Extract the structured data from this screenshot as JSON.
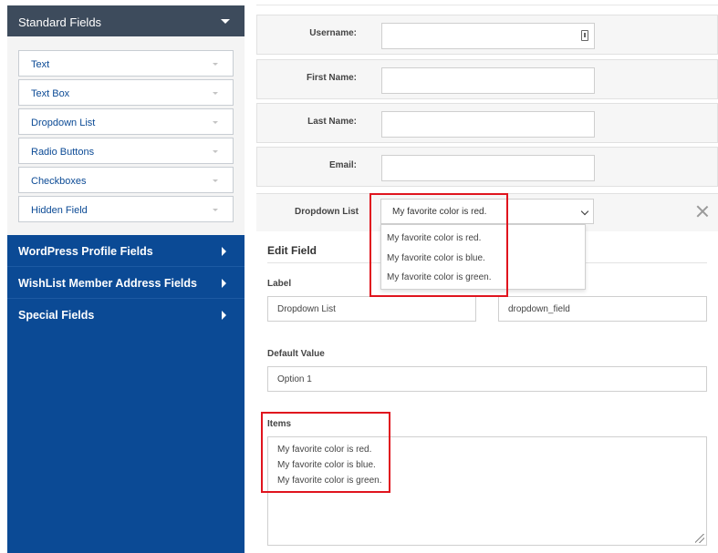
{
  "sidebar": {
    "header": "Standard Fields",
    "standard_fields": [
      "Text",
      "Text Box",
      "Dropdown List",
      "Radio Buttons",
      "Checkboxes",
      "Hidden Field"
    ],
    "sections": [
      "WordPress Profile Fields",
      "WishList Member Address Fields",
      "Special Fields"
    ],
    "colors": {
      "background": "#0b4a95",
      "header": "#3d4b5c"
    }
  },
  "form": {
    "rows": [
      {
        "label": "Username:"
      },
      {
        "label": "First Name:"
      },
      {
        "label": "Last Name:"
      },
      {
        "label": "Email:"
      }
    ],
    "dropdown": {
      "label": "Dropdown List",
      "selected": "My favorite color is red.",
      "options": [
        "My favorite color is red.",
        "My favorite color is blue.",
        "My favorite color is green."
      ]
    }
  },
  "edit_field": {
    "title": "Edit Field",
    "label_caption": "Label",
    "label_value": "Dropdown List",
    "name_value": "dropdown_field",
    "default_caption": "Default Value",
    "default_value": "Option 1",
    "items_caption": "Items",
    "items": [
      "My favorite color is red.",
      "My favorite color is blue.",
      "My favorite color is green."
    ]
  },
  "highlight_color": "#e0141e"
}
